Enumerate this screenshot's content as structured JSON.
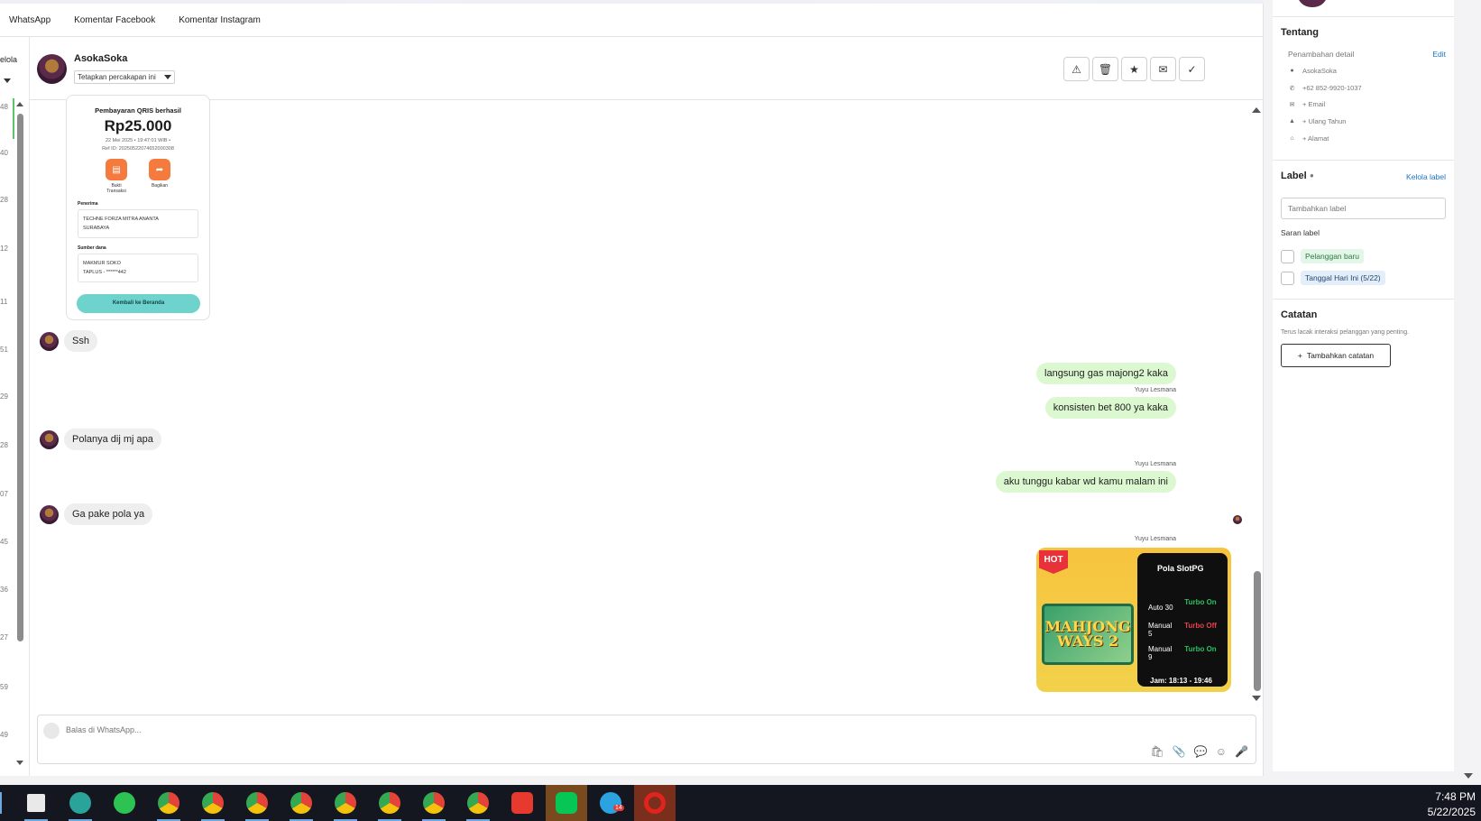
{
  "tabs": [
    "WhatsApp",
    "Komentar Facebook",
    "Komentar Instagram"
  ],
  "left_strip": {
    "kelola": "elola",
    "numbers": [
      "48",
      "40",
      "28",
      "12",
      "11",
      "51",
      "29",
      "28",
      "07",
      "45",
      "36",
      "27",
      "59",
      "49"
    ]
  },
  "contact": {
    "name": "AsokaSoka",
    "assign_label": "Tetapkan percakapan ini"
  },
  "header_actions": [
    "alert-icon",
    "trash-icon",
    "star-icon",
    "mail-icon",
    "check-icon"
  ],
  "receipt": {
    "title": "Pembayaran QRIS berhasil",
    "amount": "Rp25.000",
    "datetime": "22 Mei 2025 • 19:47:01 WIB •",
    "ref": "Ref ID: 20250522074652000308",
    "action1": "Bukti Transaksi",
    "action2": "Bagikan",
    "penerima_label": "Penerima",
    "penerima_line1": "TECHNE FORZA MITRA ANANTA",
    "penerima_line2": "SURABAYA",
    "sumber_label": "Sumber dana",
    "sumber_line1": "MAKMUR SOKO",
    "sumber_line2": "TAPLUS - ******442",
    "back_button": "Kembali ke Beranda"
  },
  "messages": {
    "in1": "Ssh",
    "out1": "langsung gas majong2 kaka",
    "sender1": "Yuyu Lesmana",
    "out2": "konsisten bet 800 ya kaka",
    "in2": "Polanya dij mj apa",
    "sender2": "Yuyu Lesmana",
    "out3": "aku tunggu kabar wd kamu malam ini",
    "in3": "Ga pake pola ya",
    "sender3": "Yuyu Lesmana"
  },
  "promo": {
    "hot": "HOT",
    "game_title_line1": "MAHJONG",
    "game_title_line2": "WAYS 2",
    "panel_title": "Pola SlotPG",
    "rows": [
      {
        "label": "Auto 30",
        "status": "Turbo On",
        "state": "on"
      },
      {
        "label": "Manual 5",
        "status": "Turbo Off",
        "state": "off"
      },
      {
        "label": "Manual 9",
        "status": "Turbo On",
        "state": "on"
      }
    ],
    "jam": "Jam: 18:13 - 19:46"
  },
  "reply": {
    "placeholder": "Balas di WhatsApp..."
  },
  "sidebar": {
    "tentang_title": "Tentang",
    "penambahan": "Penambahan detail",
    "edit": "Edit",
    "details": [
      {
        "icon": "person-icon",
        "glyph": "●",
        "text": "AsokaSoka"
      },
      {
        "icon": "phone-icon",
        "glyph": "✆",
        "text": "+62 852-9920-1037"
      },
      {
        "icon": "email-icon",
        "glyph": "✉",
        "text": "+ Email"
      },
      {
        "icon": "cake-icon",
        "glyph": "▲",
        "text": "+ Ulang Tahun"
      },
      {
        "icon": "home-icon",
        "glyph": "⌂",
        "text": "+ Alamat"
      }
    ],
    "label_title": "Label",
    "kelola_label": "Kelola label",
    "label_placeholder": "Tambahkan label",
    "saran_label": "Saran label",
    "tag1": "Pelanggan baru",
    "tag2": "Tanggal Hari Ini (5/22)",
    "catatan_title": "Catatan",
    "catatan_desc": "Terus lacak interaksi pelanggan yang penting.",
    "add_note": "Tambahkan catatan"
  },
  "taskbar": {
    "time": "7:48 PM",
    "date": "5/22/2025",
    "telegram_badge": "14"
  }
}
